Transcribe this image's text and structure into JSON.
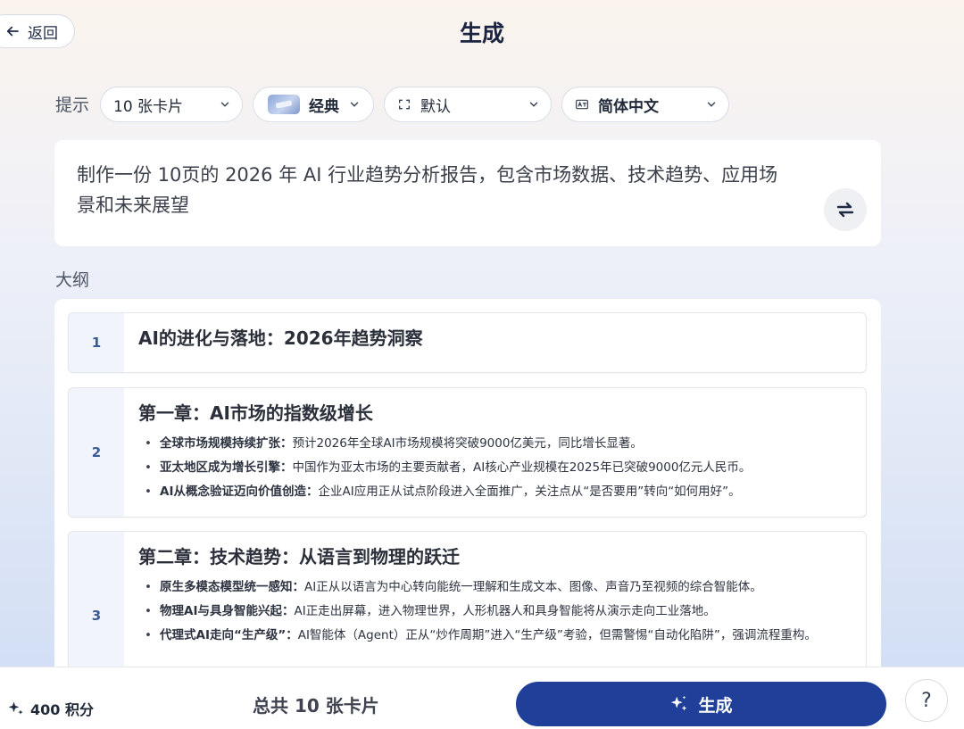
{
  "header": {
    "back_label": "返回",
    "title": "生成"
  },
  "prompt_row": {
    "label": "提示",
    "chips": [
      {
        "label": "10 张卡片"
      },
      {
        "label": "经典"
      },
      {
        "label": "默认",
        "icon": "aspect-ratio-icon"
      },
      {
        "label": "简体中文",
        "icon": "language-icon"
      }
    ]
  },
  "prompt_text": "制作一份 10页的 2026 年 AI 行业趋势分析报告，包含市场数据、技术趋势、应用场景和未来展望",
  "outline": {
    "label": "大纲",
    "items": [
      {
        "num": "1",
        "title": "AI的进化与落地：2026年趋势洞察",
        "bullets": []
      },
      {
        "num": "2",
        "title": "第一章：AI市场的指数级增长",
        "bullets": [
          {
            "head": "全球市场规模持续扩张：",
            "text": "预计2026年全球AI市场规模将突破9000亿美元，同比增长显著。"
          },
          {
            "head": "亚太地区成为增长引擎：",
            "text": "中国作为亚太市场的主要贡献者，AI核心产业规模在2025年已突破9000亿元人民币。"
          },
          {
            "head": "AI从概念验证迈向价值创造：",
            "text": "企业AI应用正从试点阶段进入全面推广，关注点从“是否要用”转向“如何用好”。"
          }
        ]
      },
      {
        "num": "3",
        "title": "第二章：技术趋势：从语言到物理的跃迁",
        "bullets": [
          {
            "head": "原生多模态模型统一感知：",
            "text": "AI正从以语言为中心转向能统一理解和生成文本、图像、声音乃至视频的综合智能体。"
          },
          {
            "head": "物理AI与具身智能兴起：",
            "text": "AI正走出屏幕，进入物理世界，人形机器人和具身智能将从演示走向工业落地。"
          },
          {
            "head": "代理式AI走向“生产级”：",
            "text": "AI智能体（Agent）正从“炒作周期”进入“生产级”考验，但需警惕“自动化陷阱”，强调流程重构。"
          }
        ]
      }
    ]
  },
  "footer": {
    "credits": "400 积分",
    "total": "总共 10 张卡片",
    "generate_label": "生成",
    "help": "?"
  },
  "colors": {
    "primary": "#1f3f99",
    "num_bg": "#f1f5fb"
  }
}
